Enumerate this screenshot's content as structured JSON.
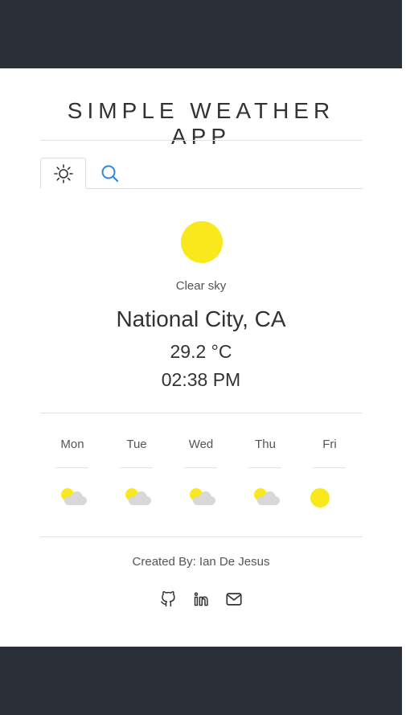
{
  "header": {
    "title": "SIMPLE WEATHER APP"
  },
  "search": {
    "value": "",
    "placeholder": ""
  },
  "theme_toggle": {
    "icon": "sun-icon"
  },
  "current": {
    "condition": "Clear sky",
    "city": "National City, CA",
    "temperature": "29.2 °C",
    "time": "02:38 PM",
    "icon": "sun-icon"
  },
  "forecast": [
    {
      "day": "Mon",
      "icon": "partly-cloudy-icon"
    },
    {
      "day": "Tue",
      "icon": "partly-cloudy-icon"
    },
    {
      "day": "Wed",
      "icon": "partly-cloudy-icon"
    },
    {
      "day": "Thu",
      "icon": "partly-cloudy-icon"
    },
    {
      "day": "Fri",
      "icon": "sun-icon"
    }
  ],
  "footer": {
    "credits": "Created By: Ian De Jesus",
    "socials": [
      "github-icon",
      "linkedin-icon",
      "mail-icon"
    ]
  },
  "colors": {
    "bar": "#2b2f38",
    "sun": "#f9e91c",
    "cloud": "#d8d8d8",
    "search_icon": "#2e86de"
  }
}
